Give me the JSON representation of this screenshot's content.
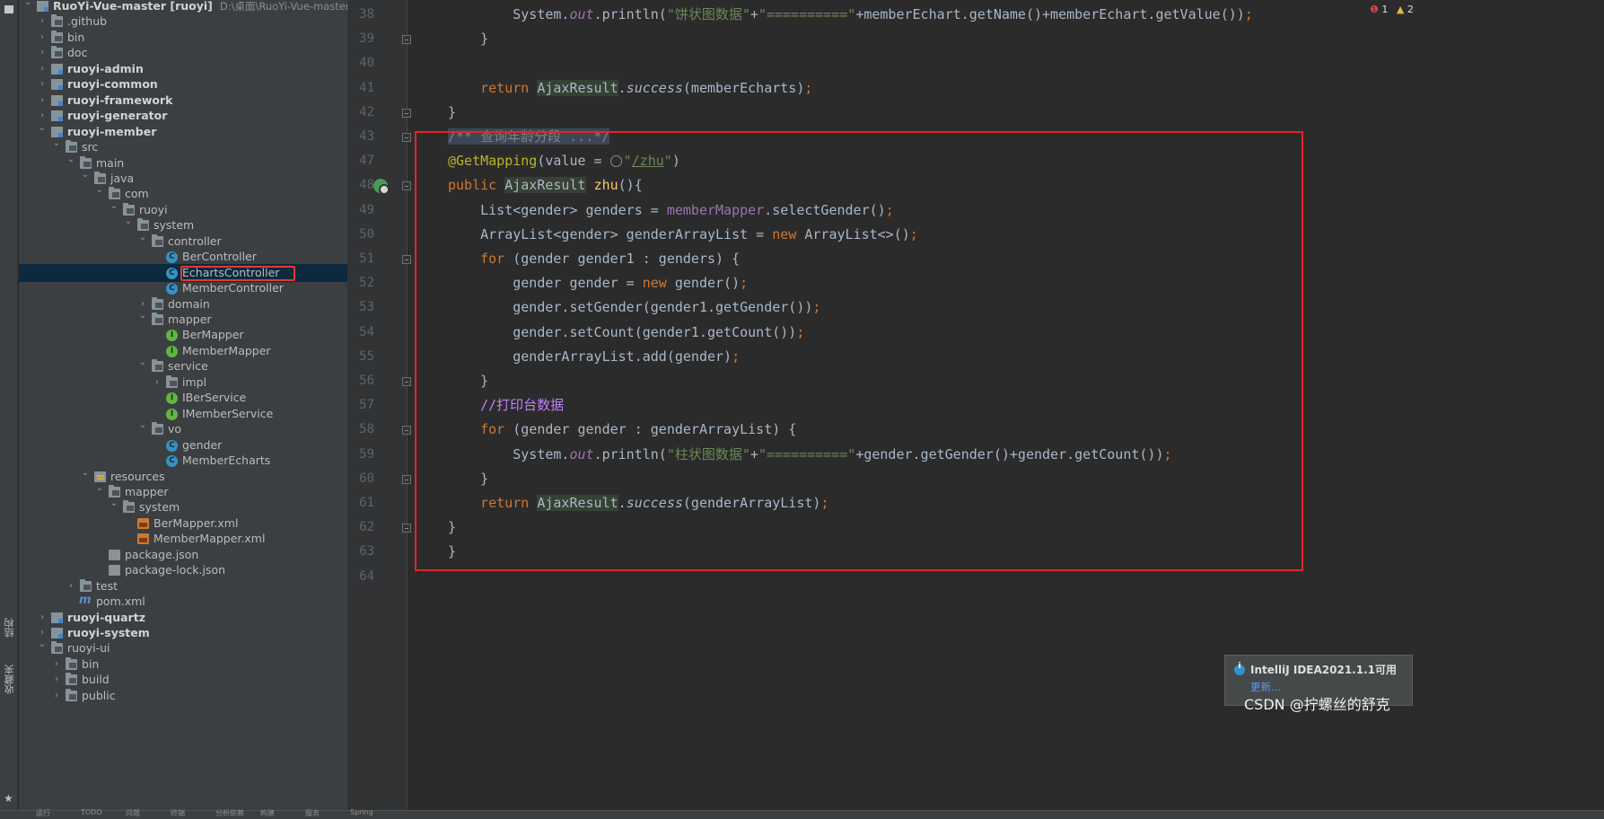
{
  "side_tabs": [
    "结构",
    "收藏夹"
  ],
  "project_tree": [
    {
      "label": "RuoYi-Vue-master [ruoyi]",
      "path": "D:\\桌面\\RuoYi-Vue-master",
      "depth": 0,
      "icon": "module",
      "expanded": true,
      "bold": false
    },
    {
      "label": ".github",
      "depth": 1,
      "icon": "folder",
      "expanded": false
    },
    {
      "label": "bin",
      "depth": 1,
      "icon": "folder",
      "expanded": false
    },
    {
      "label": "doc",
      "depth": 1,
      "icon": "folder",
      "expanded": false
    },
    {
      "label": "ruoyi-admin",
      "depth": 1,
      "icon": "module",
      "expanded": false,
      "bold": true
    },
    {
      "label": "ruoyi-common",
      "depth": 1,
      "icon": "module",
      "expanded": false,
      "bold": true
    },
    {
      "label": "ruoyi-framework",
      "depth": 1,
      "icon": "module",
      "expanded": false,
      "bold": true
    },
    {
      "label": "ruoyi-generator",
      "depth": 1,
      "icon": "module",
      "expanded": false,
      "bold": true
    },
    {
      "label": "ruoyi-member",
      "depth": 1,
      "icon": "module",
      "expanded": true,
      "bold": true
    },
    {
      "label": "src",
      "depth": 2,
      "icon": "folder",
      "expanded": true
    },
    {
      "label": "main",
      "depth": 3,
      "icon": "folder",
      "expanded": true
    },
    {
      "label": "java",
      "depth": 4,
      "icon": "folder",
      "expanded": true
    },
    {
      "label": "com",
      "depth": 5,
      "icon": "folder",
      "expanded": true
    },
    {
      "label": "ruoyi",
      "depth": 6,
      "icon": "folder",
      "expanded": true
    },
    {
      "label": "system",
      "depth": 7,
      "icon": "folder",
      "expanded": true
    },
    {
      "label": "controller",
      "depth": 8,
      "icon": "folder",
      "expanded": true
    },
    {
      "label": "BerController",
      "depth": 9,
      "icon": "class"
    },
    {
      "label": "EchartsController",
      "depth": 9,
      "icon": "class",
      "selected": true
    },
    {
      "label": "MemberController",
      "depth": 9,
      "icon": "class"
    },
    {
      "label": "domain",
      "depth": 8,
      "icon": "folder",
      "expanded": false
    },
    {
      "label": "mapper",
      "depth": 8,
      "icon": "folder",
      "expanded": true
    },
    {
      "label": "BerMapper",
      "depth": 9,
      "icon": "interface"
    },
    {
      "label": "MemberMapper",
      "depth": 9,
      "icon": "interface"
    },
    {
      "label": "service",
      "depth": 8,
      "icon": "folder",
      "expanded": true
    },
    {
      "label": "impl",
      "depth": 9,
      "icon": "folder",
      "expanded": false
    },
    {
      "label": "IBerService",
      "depth": 9,
      "icon": "interface"
    },
    {
      "label": "IMemberService",
      "depth": 9,
      "icon": "interface"
    },
    {
      "label": "vo",
      "depth": 8,
      "icon": "folder",
      "expanded": true
    },
    {
      "label": "gender",
      "depth": 9,
      "icon": "class"
    },
    {
      "label": "MemberEcharts",
      "depth": 9,
      "icon": "class"
    },
    {
      "label": "resources",
      "depth": 4,
      "icon": "resources",
      "expanded": true
    },
    {
      "label": "mapper",
      "depth": 5,
      "icon": "folder",
      "expanded": true
    },
    {
      "label": "system",
      "depth": 6,
      "icon": "folder",
      "expanded": true
    },
    {
      "label": "BerMapper.xml",
      "depth": 7,
      "icon": "xml"
    },
    {
      "label": "MemberMapper.xml",
      "depth": 7,
      "icon": "xml"
    },
    {
      "label": "package.json",
      "depth": 5,
      "icon": "json"
    },
    {
      "label": "package-lock.json",
      "depth": 5,
      "icon": "json"
    },
    {
      "label": "test",
      "depth": 3,
      "icon": "folder",
      "expanded": false
    },
    {
      "label": "pom.xml",
      "depth": 3,
      "icon": "pom"
    },
    {
      "label": "ruoyi-quartz",
      "depth": 1,
      "icon": "module",
      "expanded": false,
      "bold": true
    },
    {
      "label": "ruoyi-system",
      "depth": 1,
      "icon": "module",
      "expanded": false,
      "bold": true
    },
    {
      "label": "ruoyi-ui",
      "depth": 1,
      "icon": "folder",
      "expanded": true
    },
    {
      "label": "bin",
      "depth": 2,
      "icon": "folder",
      "expanded": false
    },
    {
      "label": "build",
      "depth": 2,
      "icon": "folder",
      "expanded": false
    },
    {
      "label": "public",
      "depth": 2,
      "icon": "folder",
      "expanded": false
    }
  ],
  "editor": {
    "line_numbers": [
      "38",
      "39",
      "40",
      "41",
      "42",
      "43",
      "47",
      "48",
      "49",
      "50",
      "51",
      "52",
      "53",
      "54",
      "55",
      "56",
      "57",
      "58",
      "59",
      "60",
      "61",
      "62",
      "63",
      "64"
    ],
    "lines": [
      [
        {
          "t": "        System.",
          "c": ""
        },
        {
          "t": "out",
          "c": "fld-it"
        },
        {
          "t": ".println(",
          "c": ""
        },
        {
          "t": "\"饼状图数据\"",
          "c": "str"
        },
        {
          "t": "+",
          "c": ""
        },
        {
          "t": "\"==========\"",
          "c": "str"
        },
        {
          "t": "+memberEchart.getName()+memberEchart.getValue())",
          "c": ""
        },
        {
          "t": ";",
          "c": "kw"
        }
      ],
      [
        {
          "t": "    }",
          "c": ""
        }
      ],
      [
        {
          "t": "",
          "c": ""
        }
      ],
      [
        {
          "t": "    ",
          "c": ""
        },
        {
          "t": "return ",
          "c": "kw"
        },
        {
          "t": "AjaxResult",
          "c": "hl"
        },
        {
          "t": ".",
          "c": ""
        },
        {
          "t": "success",
          "c": "it"
        },
        {
          "t": "(memberEcharts)",
          "c": ""
        },
        {
          "t": ";",
          "c": "kw"
        }
      ],
      [
        {
          "t": "}",
          "c": ""
        }
      ],
      [
        {
          "t": "/** 查询年龄分段 ...*/",
          "c": "cmt fold-bg"
        }
      ],
      [
        {
          "t": "@GetMapping",
          "c": "ann"
        },
        {
          "t": "(value = ",
          "c": ""
        },
        {
          "t": "GLOBE",
          "c": "globe"
        },
        {
          "t": "\"",
          "c": "str"
        },
        {
          "t": "/zhu",
          "c": "link"
        },
        {
          "t": "\"",
          "c": "str"
        },
        {
          "t": ")",
          "c": ""
        }
      ],
      [
        {
          "t": "public ",
          "c": "kw"
        },
        {
          "t": "AjaxResult",
          "c": "hl"
        },
        {
          "t": " ",
          "c": ""
        },
        {
          "t": "zhu",
          "c": "mth"
        },
        {
          "t": "(){",
          "c": ""
        }
      ],
      [
        {
          "t": "    List<gender> genders = ",
          "c": ""
        },
        {
          "t": "memberMapper",
          "c": "fld"
        },
        {
          "t": ".selectGender()",
          "c": ""
        },
        {
          "t": ";",
          "c": "kw"
        }
      ],
      [
        {
          "t": "    ArrayList<gender> genderArrayList = ",
          "c": ""
        },
        {
          "t": "new ",
          "c": "kw"
        },
        {
          "t": "ArrayList<>()",
          "c": ""
        },
        {
          "t": ";",
          "c": "kw"
        }
      ],
      [
        {
          "t": "    ",
          "c": ""
        },
        {
          "t": "for ",
          "c": "kw"
        },
        {
          "t": "(gender gender1 : genders) {",
          "c": ""
        }
      ],
      [
        {
          "t": "        gender gender = ",
          "c": ""
        },
        {
          "t": "new ",
          "c": "kw"
        },
        {
          "t": "gender()",
          "c": ""
        },
        {
          "t": ";",
          "c": "kw"
        }
      ],
      [
        {
          "t": "        gender.setGender(gender1.getGender())",
          "c": ""
        },
        {
          "t": ";",
          "c": "kw"
        }
      ],
      [
        {
          "t": "        gender.setCount(gender1.getCount())",
          "c": ""
        },
        {
          "t": ";",
          "c": "kw"
        }
      ],
      [
        {
          "t": "        genderArrayList.add(gender)",
          "c": ""
        },
        {
          "t": ";",
          "c": "kw"
        }
      ],
      [
        {
          "t": "    }",
          "c": ""
        }
      ],
      [
        {
          "t": "    ",
          "c": ""
        },
        {
          "t": "//打印台数据",
          "c": "todo-cmt"
        }
      ],
      [
        {
          "t": "    ",
          "c": ""
        },
        {
          "t": "for ",
          "c": "kw"
        },
        {
          "t": "(gender gender : genderArrayList) {",
          "c": ""
        }
      ],
      [
        {
          "t": "        System.",
          "c": ""
        },
        {
          "t": "out",
          "c": "fld-it"
        },
        {
          "t": ".println(",
          "c": ""
        },
        {
          "t": "\"柱状图数据\"",
          "c": "str"
        },
        {
          "t": "+",
          "c": ""
        },
        {
          "t": "\"==========\"",
          "c": "str"
        },
        {
          "t": "+gender.getGender()+gender.getCount())",
          "c": ""
        },
        {
          "t": ";",
          "c": "kw"
        }
      ],
      [
        {
          "t": "    }",
          "c": ""
        }
      ],
      [
        {
          "t": "    ",
          "c": ""
        },
        {
          "t": "return ",
          "c": "kw"
        },
        {
          "t": "AjaxResult",
          "c": "hl"
        },
        {
          "t": ".",
          "c": ""
        },
        {
          "t": "success",
          "c": "it"
        },
        {
          "t": "(genderArrayList)",
          "c": ""
        },
        {
          "t": ";",
          "c": "kw"
        }
      ],
      [
        {
          "t": "}",
          "c": ""
        }
      ],
      [
        {
          "t": "}",
          "c": ""
        }
      ],
      [
        {
          "t": "",
          "c": ""
        }
      ]
    ]
  },
  "problems": {
    "errors": "1",
    "warnings": "2"
  },
  "notification": {
    "title": "IntelliJ IDEA2021.1.1可用",
    "link": "更新..."
  },
  "watermark": "CSDN @拧螺丝的舒克",
  "status_items": [
    "运行",
    "TODO",
    "问题",
    "终端",
    "分析依赖",
    "构建",
    "服务",
    "Spring"
  ]
}
